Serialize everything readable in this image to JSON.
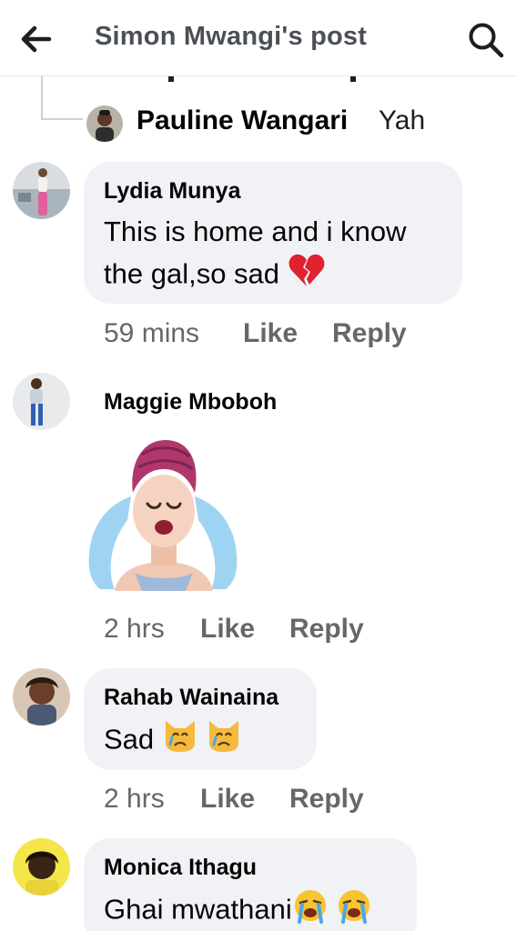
{
  "header": {
    "title": "Simon Mwangi's post",
    "back_icon": "arrow-left-icon",
    "search_icon": "search-icon"
  },
  "thread_reply": {
    "author": "Pauline Wangari",
    "text": "Yah"
  },
  "comments": [
    {
      "author": "Lydia Munya",
      "text_line1": "This is home and i know",
      "text_line2": "the gal,so sad",
      "emoji": "broken-heart-icon",
      "time": "59 mins",
      "like": "Like",
      "reply": "Reply"
    },
    {
      "author": "Maggie Mboboh",
      "sticker": "crying-woman-sticker",
      "time": "2 hrs",
      "like": "Like",
      "reply": "Reply"
    },
    {
      "author": "Rahab Wainaina",
      "text": "Sad",
      "emoji": "crying-cat-icon",
      "time": "2 hrs",
      "like": "Like",
      "reply": "Reply"
    },
    {
      "author": "Monica Ithagu",
      "text": "Ghai mwathani",
      "emoji": "loudly-crying-face-icon"
    }
  ],
  "colors": {
    "bubble": "#f0f2f5",
    "meta": "#65676b",
    "title": "#4b4f56",
    "thread_line": "#ccd0d5"
  }
}
